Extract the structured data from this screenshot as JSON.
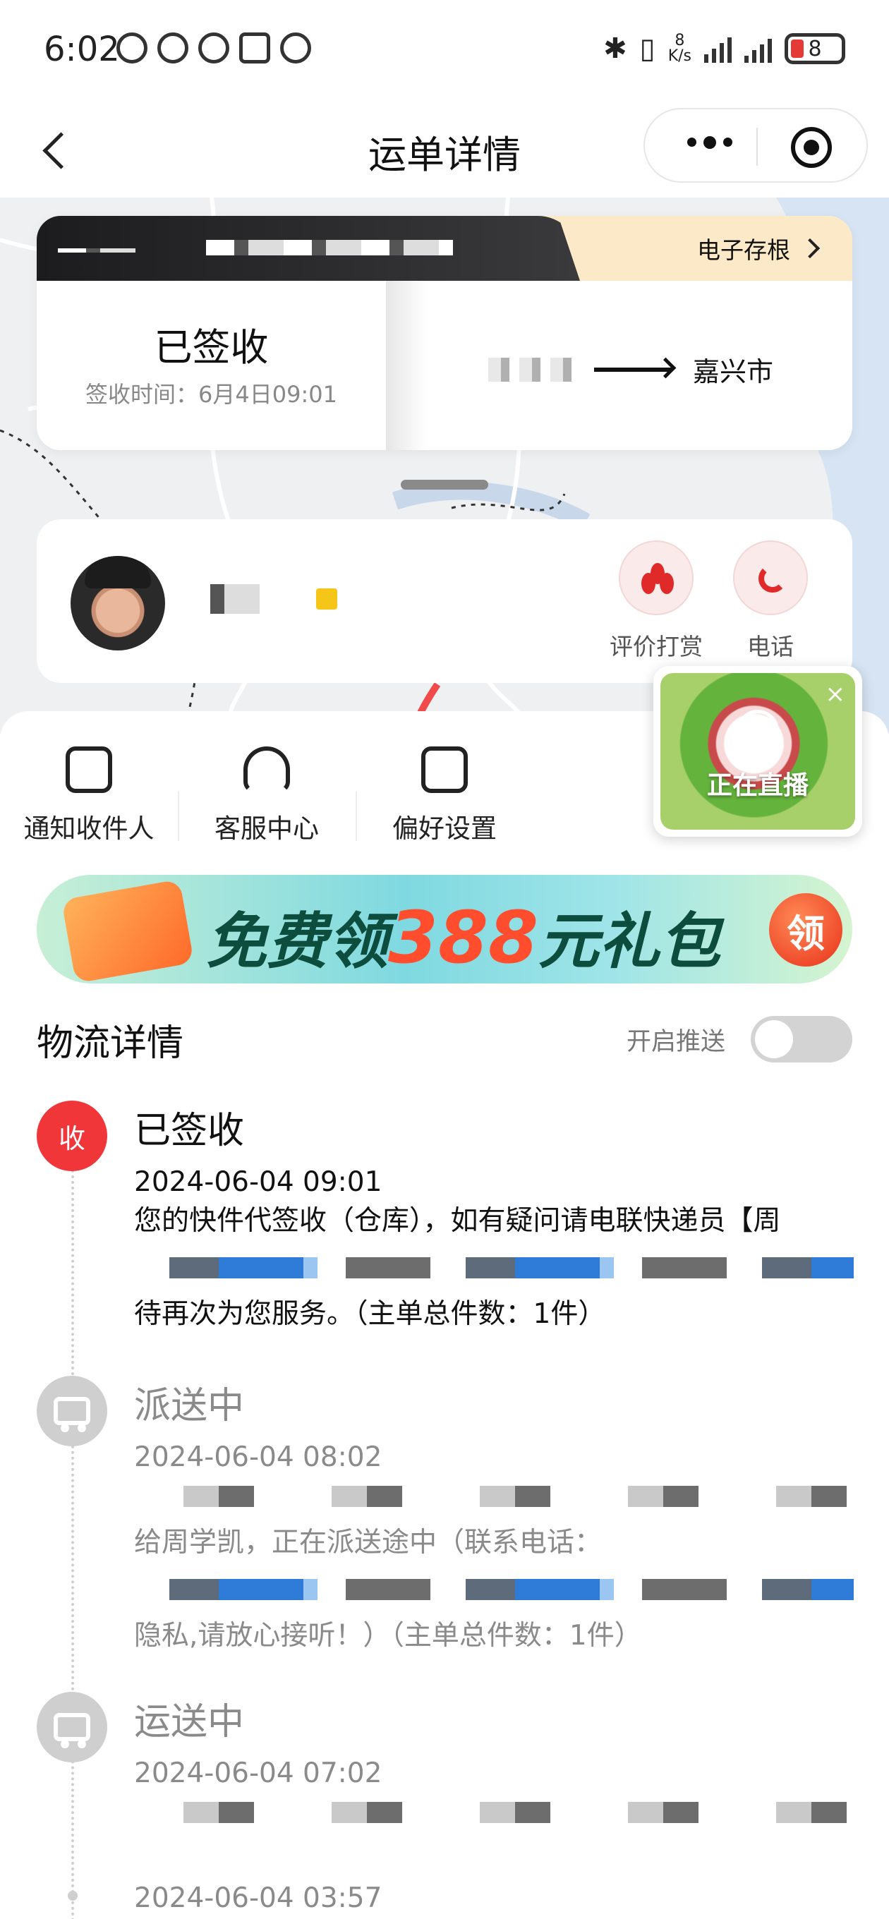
{
  "status_bar": {
    "time": "6:02",
    "net_speed_value": "8",
    "net_speed_unit": "K/s",
    "battery": "8"
  },
  "header": {
    "title": "运单详情"
  },
  "waybill": {
    "stub_label": "电子存根",
    "status": "已签收",
    "sign_time": "签收时间：6月4日09:01",
    "destination": "嘉兴市"
  },
  "courier": {
    "actions": [
      {
        "label": "评价打赏",
        "icon": "red-flower-icon"
      },
      {
        "label": "电话",
        "icon": "phone-icon"
      }
    ]
  },
  "quick_actions": [
    {
      "label": "通知收件人",
      "icon": "share-icon"
    },
    {
      "label": "客服中心",
      "icon": "headset-icon"
    },
    {
      "label": "偏好设置",
      "icon": "settings-card-icon"
    }
  ],
  "live": {
    "label": "正在直播",
    "close": "×"
  },
  "promo": {
    "prefix": "免费领",
    "amount": "388",
    "suffix": "元礼包",
    "button": "领"
  },
  "logistics": {
    "title": "物流详情",
    "push_label": "开启推送",
    "push_enabled": false,
    "signed_badge": "收",
    "events": [
      {
        "status": "已签收",
        "time": "2024-06-04 09:01",
        "desc_before": "您的快件代签收（仓库），如有疑问请电联快递员【周",
        "desc_after": "待再次为您服务。（主单总件数：1件）"
      },
      {
        "status": "派送中",
        "time": "2024-06-04 08:02",
        "desc_before": "给周学凯，正在派送途中（联系电话：",
        "desc_after": "隐私,请放心接听！）（主单总件数：1件）"
      },
      {
        "status": "运送中",
        "time": "2024-06-04 07:02"
      },
      {
        "time": "2024-06-04 03:57"
      }
    ]
  }
}
